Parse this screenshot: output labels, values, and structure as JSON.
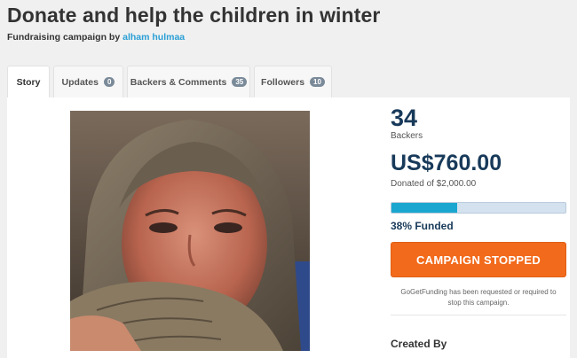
{
  "campaign": {
    "title": "Donate and help the children in winter",
    "byline_prefix": "Fundraising campaign by",
    "author": "alham hulmaa"
  },
  "tabs": [
    {
      "label": "Story",
      "count": null,
      "active": true
    },
    {
      "label": "Updates",
      "count": "0",
      "active": false
    },
    {
      "label": "Backers & Comments",
      "count": "35",
      "active": false
    },
    {
      "label": "Followers",
      "count": "10",
      "active": false
    }
  ],
  "stats": {
    "backers_count": "34",
    "backers_label": "Backers",
    "amount": "US$760.00",
    "goal_text": "Donated of $2,000.00",
    "progress_fraction": 0.38,
    "funded_text": "38% Funded",
    "button_label": "CAMPAIGN STOPPED",
    "notice_line1": "GoGetFunding has been requested or required to",
    "notice_line2": "stop this campaign.",
    "created_by_label": "Created By"
  },
  "colors": {
    "accent_blue": "#2a9fd6",
    "navy": "#183a5a",
    "orange": "#f26a1b",
    "progress": "#1aa6cf"
  }
}
